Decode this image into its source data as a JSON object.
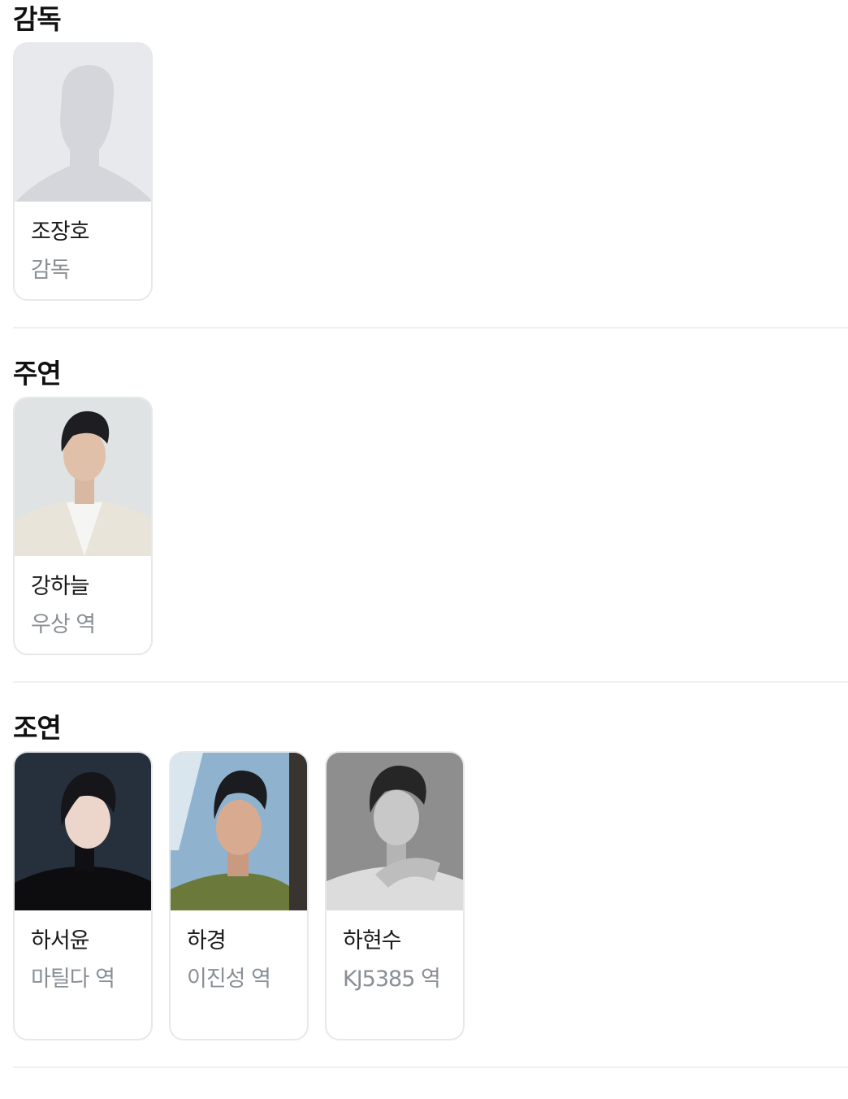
{
  "sections": [
    {
      "title": "감독",
      "cards": [
        {
          "name": "조장호",
          "role": "감독",
          "photo": "placeholder-person-icon"
        }
      ]
    },
    {
      "title": "주연",
      "cards": [
        {
          "name": "강하늘",
          "role": "우상 역",
          "photo": "actor-photo"
        }
      ]
    },
    {
      "title": "조연",
      "cards": [
        {
          "name": "하서윤",
          "role": "마틸다 역",
          "photo": "actor-photo"
        },
        {
          "name": "하경",
          "role": "이진성 역",
          "photo": "actor-photo"
        },
        {
          "name": "하현수",
          "role": "KJ5385 역",
          "photo": "actor-photo"
        }
      ]
    }
  ],
  "colors": {
    "title": "#111111",
    "name": "#1a1a1a",
    "role": "#8a8f96",
    "card_border": "#e6e8eb",
    "divider": "#eef0f2",
    "placeholder_bg": "#e8e9ec",
    "placeholder_figure": "#d4d6db"
  }
}
